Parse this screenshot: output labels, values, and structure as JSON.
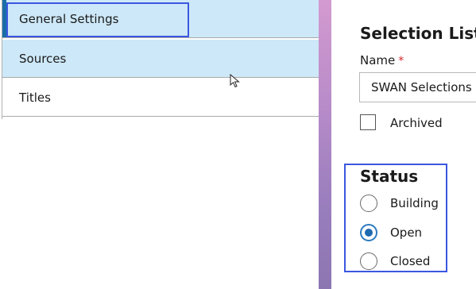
{
  "sidebar": {
    "items": [
      {
        "label": "General Settings",
        "selected": true
      },
      {
        "label": "Sources",
        "selected": false
      },
      {
        "label": "Titles",
        "selected": false
      }
    ]
  },
  "form": {
    "section_title": "Selection List",
    "name_label": "Name",
    "required_marker": "*",
    "name_value": "SWAN Selections",
    "archived_label": "Archived",
    "archived_checked": false
  },
  "status": {
    "title": "Status",
    "options": [
      {
        "label": "Building",
        "checked": false
      },
      {
        "label": "Open",
        "checked": true
      },
      {
        "label": "Closed",
        "checked": false
      }
    ]
  },
  "colors": {
    "selected_bg": "#cde8f8",
    "accent": "#1a6ea8",
    "highlight": "#3b57e0",
    "required": "#d9262b"
  },
  "icons": {
    "cursor": "mouse-pointer-icon"
  }
}
